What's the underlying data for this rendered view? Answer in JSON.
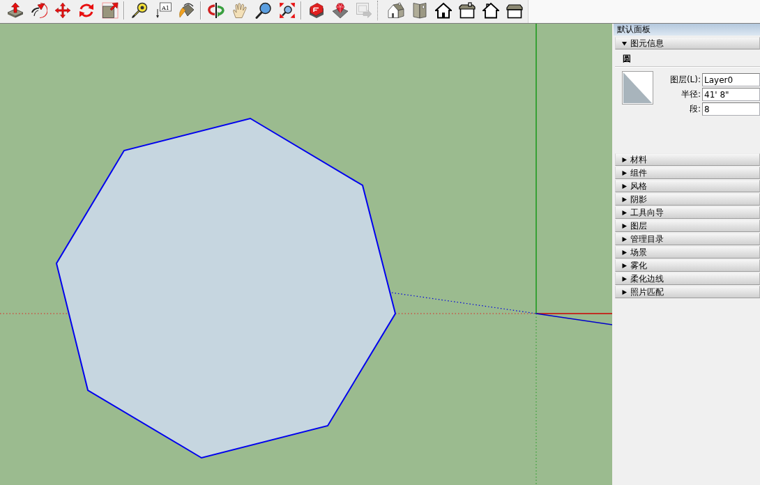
{
  "toolbars": [
    {
      "groups": [
        {
          "buttons": [
            {
              "disabled": false
            },
            {
              "disabled": false
            },
            {
              "disabled": false
            },
            {
              "disabled": false
            },
            {
              "disabled": false
            }
          ]
        },
        {
          "buttons": [
            {
              "disabled": false
            },
            {
              "disabled": false,
              "text": "A1"
            },
            {
              "disabled": false
            }
          ]
        },
        {
          "buttons": [
            {
              "disabled": false
            },
            {
              "disabled": false
            },
            {
              "disabled": false
            },
            {
              "disabled": false
            }
          ]
        },
        {
          "buttons": [
            {
              "disabled": false
            },
            {
              "disabled": false
            },
            {
              "disabled": true
            }
          ]
        }
      ]
    },
    {
      "groups": [
        {
          "buttons": [
            {
              "disabled": false
            },
            {
              "disabled": false
            },
            {
              "disabled": false
            },
            {
              "disabled": false
            },
            {
              "disabled": false
            },
            {
              "disabled": false
            }
          ]
        }
      ]
    }
  ],
  "panel": {
    "title": "默认面板",
    "sections": [
      {
        "label": "图元信息",
        "expanded": true,
        "entity_type": "圆",
        "fields": [
          {
            "label": "图层(L):",
            "value": "Layer0"
          },
          {
            "label": "半径:",
            "value": "41' 8\""
          },
          {
            "label": "段:",
            "value": "8"
          }
        ]
      },
      {
        "label": "材料",
        "expanded": false
      },
      {
        "label": "组件",
        "expanded": false
      },
      {
        "label": "风格",
        "expanded": false
      },
      {
        "label": "阴影",
        "expanded": false
      },
      {
        "label": "工具向导",
        "expanded": false
      },
      {
        "label": "图层",
        "expanded": false
      },
      {
        "label": "管理目录",
        "expanded": false
      },
      {
        "label": "场景",
        "expanded": false
      },
      {
        "label": "雾化",
        "expanded": false
      },
      {
        "label": "柔化边线",
        "expanded": false
      },
      {
        "label": "照片匹配",
        "expanded": false
      }
    ]
  }
}
